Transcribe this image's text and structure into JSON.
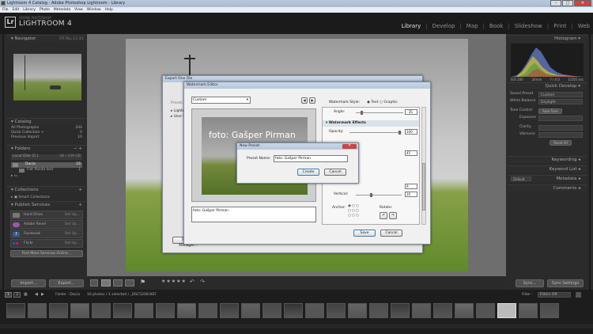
{
  "window": {
    "title": "Lightroom 4 Catalog - Adobe Photoshop Lightroom - Library",
    "controls": [
      "–",
      "□",
      "✕"
    ]
  },
  "menu": [
    "File",
    "Edit",
    "Library",
    "Photo",
    "Metadata",
    "View",
    "Window",
    "Help"
  ],
  "app": {
    "logo": "Lr",
    "vendor": "ADOBE PHOTOSHOP",
    "name": "LIGHTROOM 4"
  },
  "modules": [
    {
      "label": "Library",
      "active": true
    },
    {
      "label": "Develop",
      "active": false
    },
    {
      "label": "Map",
      "active": false
    },
    {
      "label": "Book",
      "active": false
    },
    {
      "label": "Slideshow",
      "active": false
    },
    {
      "label": "Print",
      "active": false
    },
    {
      "label": "Web",
      "active": false
    }
  ],
  "left": {
    "navigator": {
      "title": "Navigator",
      "zoom": [
        "FIT",
        "FILL",
        "1:1",
        "3:1"
      ]
    },
    "catalog": {
      "title": "Catalog",
      "items": [
        {
          "label": "All Photographs",
          "count": "244"
        },
        {
          "label": "Quick Collection +",
          "count": "0"
        },
        {
          "label": "Previous Import",
          "count": "10"
        }
      ]
    },
    "folders": {
      "title": "Folders",
      "volume": {
        "label": "Local Disk (C:)",
        "info": "48 / 109 GB"
      },
      "items": [
        {
          "label": "Dacia",
          "count": "16"
        },
        {
          "label": "Fiat Panda test",
          "count": "1"
        }
      ]
    },
    "collections": {
      "title": "Collections",
      "items": [
        {
          "label": "Smart Collections"
        }
      ]
    },
    "publish": {
      "title": "Publish Services",
      "items": [
        {
          "label": "Hard Drive",
          "action": "Set Up..."
        },
        {
          "label": "Adobe Revel",
          "action": "Set Up..."
        },
        {
          "label": "Facebook",
          "action": "Set Up..."
        },
        {
          "label": "Flickr",
          "action": "Set Up..."
        }
      ],
      "find_more": "Find More Services Online..."
    },
    "import_label": "Import...",
    "export_label": "Export..."
  },
  "right": {
    "histogram": {
      "title": "Histogram",
      "readouts": [
        "ISO 200",
        "24mm",
        "f / 4.0",
        "1/250 sec"
      ]
    },
    "quick_develop": {
      "title": "Quick Develop",
      "saved_preset": {
        "label": "Saved Preset",
        "value": "Custom"
      },
      "white_balance": {
        "label": "White Balance",
        "value": "Daylight"
      },
      "tone_control": {
        "label": "Tone Control",
        "value": "Auto Tone"
      },
      "rows": [
        "Exposure",
        "Clarity",
        "Vibrance"
      ],
      "reset": "Reset All"
    },
    "keywording": "Keywording",
    "keyword_list": "Keyword List",
    "metadata": {
      "title": "Metadata",
      "preset": "Default"
    },
    "comments": "Comments",
    "sync_label": "Sync...",
    "sync_settings_label": "Sync Settings"
  },
  "toolbar": {
    "stars": "★★★★★"
  },
  "filmstrip": {
    "pages": [
      "1",
      "2"
    ],
    "source": "Folder : Dacia",
    "count": "16 photos / 1 selected / _DSC5208.NEF",
    "filter_label": "Filter :",
    "filter_value": "Filters Off",
    "thumb_count": 26
  },
  "export_dialog": {
    "title": "Export One File",
    "preset_label": "Preset:",
    "tree": [
      "Lightroom Presets",
      "User Presets"
    ],
    "plugin_btn": "Plug-in Manager..."
  },
  "watermark_editor": {
    "title": "Watermark Editor",
    "preset": "Custom",
    "nav_prev": "◀",
    "nav_next": "▶",
    "preview_text": "foto: Gašper Pirman",
    "text_value": "foto: Gašper Pirman",
    "style_label": "Watermark Style:",
    "style_text": "Text",
    "style_graphic": "Graphic",
    "angle_label": "Angle:",
    "angle_value": "- 35",
    "effects_title": "Watermark Effects",
    "opacity_label": "Opacity:",
    "opacity_value": "100",
    "horizontal_value": "45",
    "vertical_label": "Vertical:",
    "vertical_value": "10",
    "offset_value": "9",
    "anchor_label": "Anchor:",
    "rotate_label": "Rotate:",
    "save_label": "Save",
    "cancel_label": "Cancel"
  },
  "new_preset": {
    "title": "New Preset",
    "name_label": "Preset Name:",
    "name_value": "foto: Gašper Pirman",
    "create_label": "Create",
    "cancel_label": "Cancel"
  },
  "colors": {
    "accent": "#5a7bb5",
    "lr_bg": "#1e1e1e",
    "panel": "#2b2b2b",
    "close_red": "#c44"
  }
}
